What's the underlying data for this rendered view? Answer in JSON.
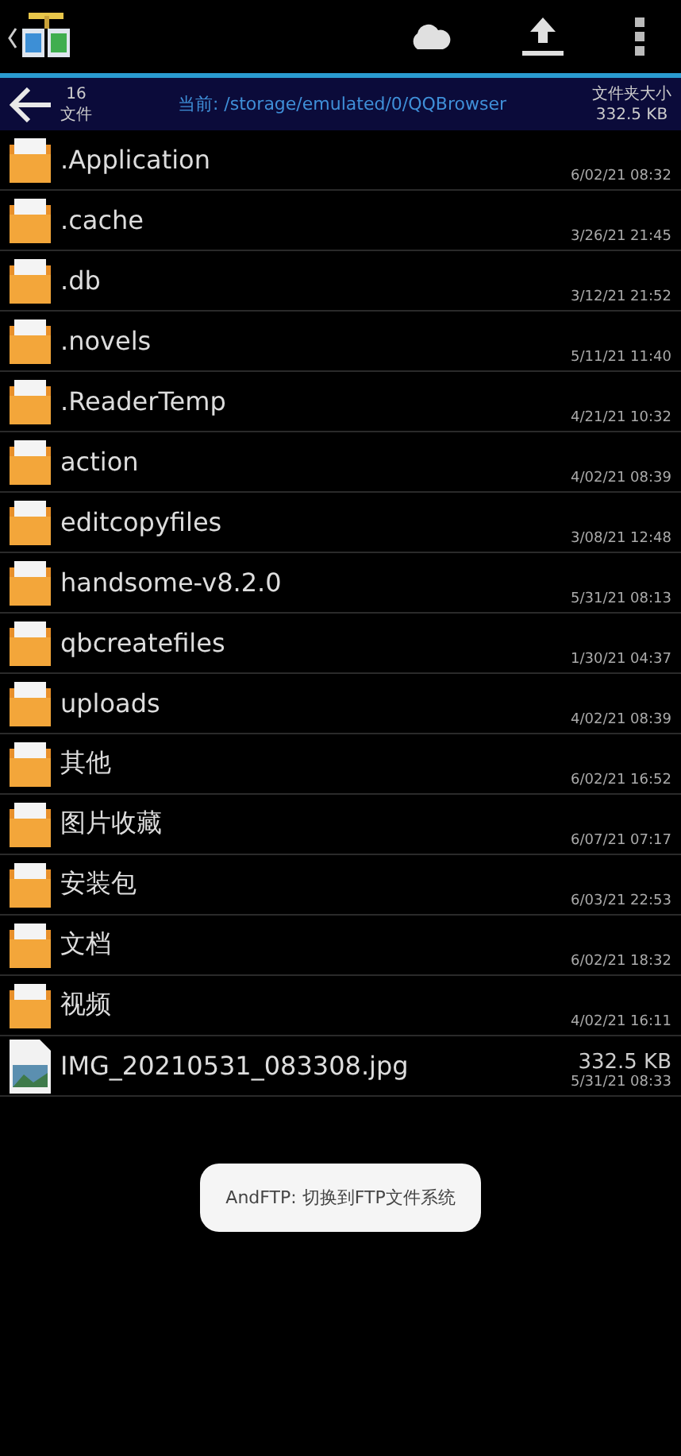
{
  "path_bar": {
    "count": "16",
    "count_label": "文件",
    "current_path": "当前: /storage/emulated/0/QQBrowser",
    "size_label": "文件夹大小",
    "size": "332.5 KB"
  },
  "files": [
    {
      "kind": "folder",
      "name": ".Application",
      "date": "6/02/21 08:32"
    },
    {
      "kind": "folder",
      "name": ".cache",
      "date": "3/26/21 21:45"
    },
    {
      "kind": "folder",
      "name": ".db",
      "date": "3/12/21 21:52"
    },
    {
      "kind": "folder",
      "name": ".novels",
      "date": "5/11/21 11:40"
    },
    {
      "kind": "folder",
      "name": ".ReaderTemp",
      "date": "4/21/21 10:32"
    },
    {
      "kind": "folder",
      "name": "action",
      "date": "4/02/21 08:39"
    },
    {
      "kind": "folder",
      "name": "editcopyfiles",
      "date": "3/08/21 12:48"
    },
    {
      "kind": "folder",
      "name": "handsome-v8.2.0",
      "date": "5/31/21 08:13"
    },
    {
      "kind": "folder",
      "name": "qbcreatefiles",
      "date": "1/30/21 04:37"
    },
    {
      "kind": "folder",
      "name": "uploads",
      "date": "4/02/21 08:39"
    },
    {
      "kind": "folder",
      "name": "其他",
      "date": "6/02/21 16:52"
    },
    {
      "kind": "folder",
      "name": "图片收藏",
      "date": "6/07/21 07:17"
    },
    {
      "kind": "folder",
      "name": "安装包",
      "date": "6/03/21 22:53"
    },
    {
      "kind": "folder",
      "name": "文档",
      "date": "6/02/21 18:32"
    },
    {
      "kind": "folder",
      "name": "视频",
      "date": "4/02/21 16:11"
    },
    {
      "kind": "image",
      "name": "IMG_20210531_083308.jpg",
      "size": "332.5 KB",
      "date": "5/31/21 08:33"
    }
  ],
  "toast": "AndFTP: 切换到FTP文件系统"
}
